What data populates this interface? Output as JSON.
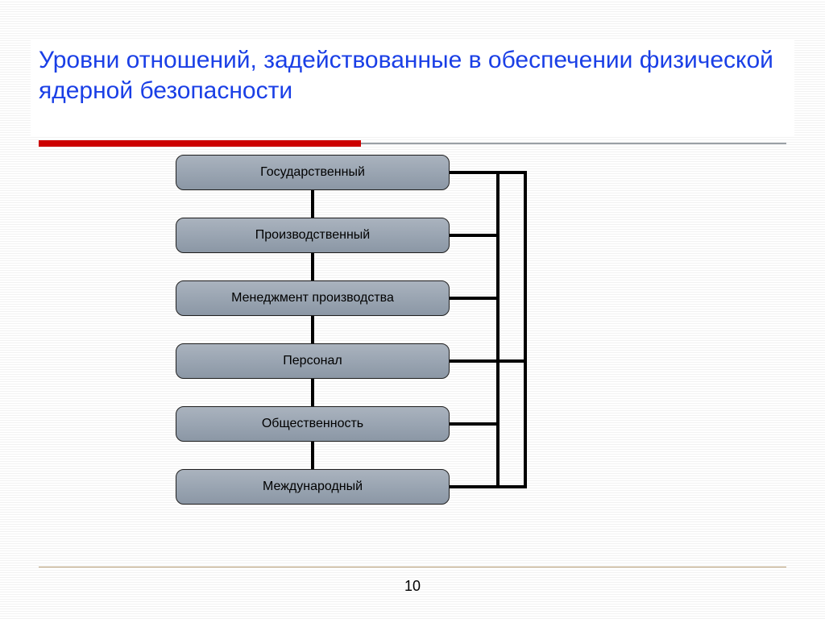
{
  "title": "Уровни отношений, задействованные в обеспечении физической ядерной безопасности",
  "page_number": "10",
  "colors": {
    "title": "#1a3fe6",
    "accent_red": "#cc0000",
    "box_fill": "#9aa5b2"
  },
  "diagram": {
    "levels": [
      {
        "label": "Государственный"
      },
      {
        "label": "Производственный"
      },
      {
        "label": "Менеджмент производства"
      },
      {
        "label": "Персонал"
      },
      {
        "label": "Общественность"
      },
      {
        "label": "Международный"
      }
    ]
  }
}
